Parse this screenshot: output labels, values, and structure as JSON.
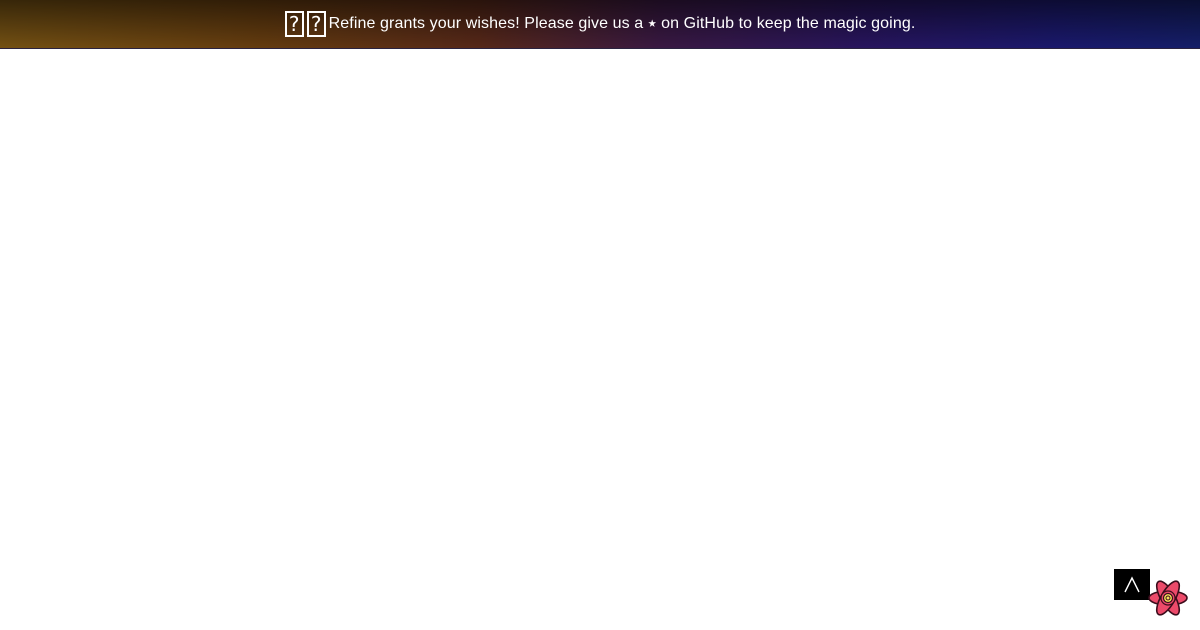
{
  "banner": {
    "text": "Refine grants your wishes! Please give us a ⭑ on GitHub to keep the magic going.",
    "emoji_icons": [
      "missing-glyph-icon",
      "missing-glyph-icon"
    ]
  },
  "back_to_top": {
    "icon": "chevron-up-icon"
  },
  "devtools_badge": {
    "icon": "atom-logo-icon",
    "colors": {
      "petals": "#ec4a6a",
      "outline": "#3b0d1c",
      "core": "#f6e35a"
    }
  }
}
